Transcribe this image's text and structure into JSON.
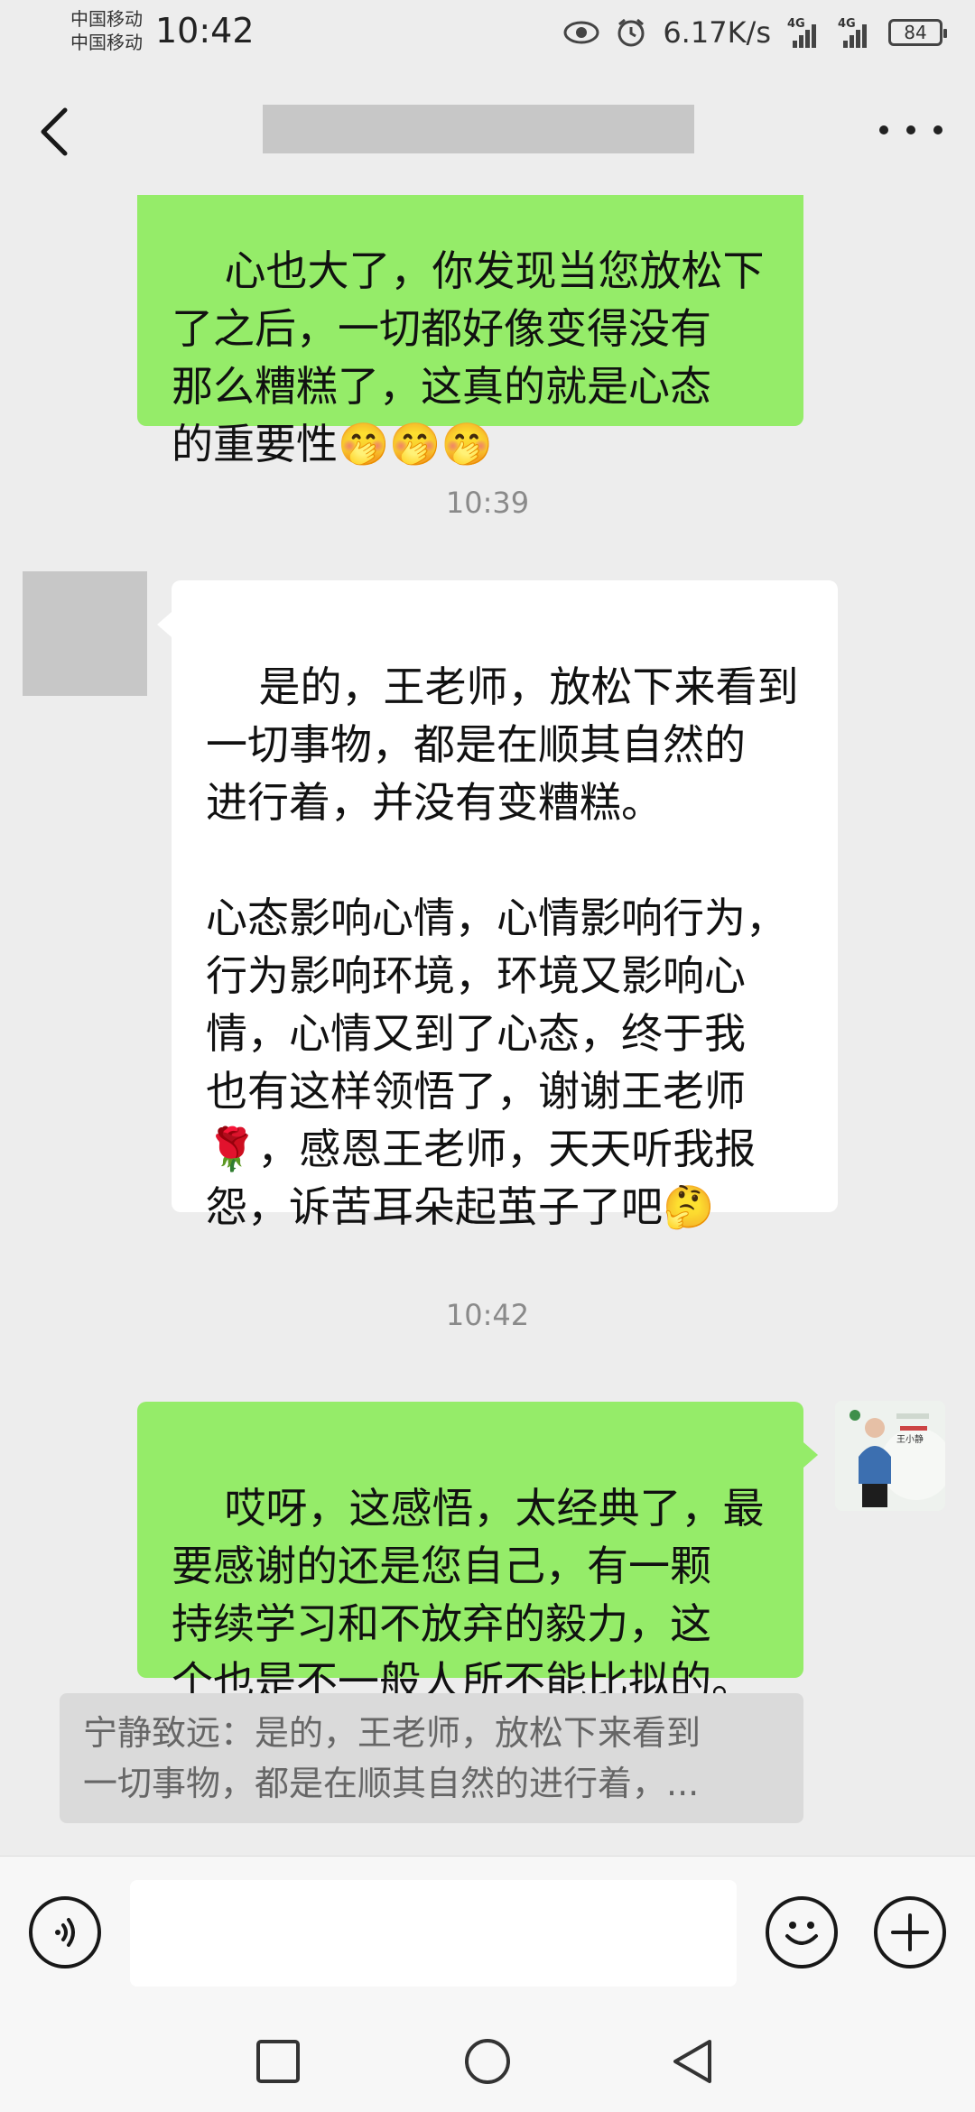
{
  "status_bar": {
    "carrier_1": "中国移动",
    "carrier_2": "中国移动",
    "time": "10:42",
    "net_speed": "6.17K/s",
    "network_1": "4G",
    "network_2": "4G",
    "battery": "84"
  },
  "header": {
    "back_icon": "chevron-left-icon",
    "more_icon": "more-dots-icon"
  },
  "messages": [
    {
      "direction": "outgoing",
      "text": "心也大了，你发现当您放松下\n了之后，一切都好像变得没有\n那么糟糕了，这真的就是心态\n的重要性🤭🤭🤭"
    },
    {
      "type": "timestamp",
      "text": "10:39"
    },
    {
      "direction": "incoming",
      "text": "是的，王老师，放松下来看到\n一切事物，都是在顺其自然的\n进行着，并没有变糟糕。\n\n心态影响心情，心情影响行为，\n行为影响环境，环境又影响心\n情，心情又到了心态，终于我\n也有这样领悟了，谢谢王老师\n🌹，感恩王老师，天天听我报\n怨，诉苦耳朵起茧子了吧🤔"
    },
    {
      "type": "timestamp",
      "text": "10:42"
    },
    {
      "direction": "outgoing",
      "text": "哎呀，这感悟，太经典了，最\n要感谢的还是您自己，有一颗\n持续学习和不放弃的毅力，这\n个也是不一般人所不能比拟的。"
    }
  ],
  "quote": {
    "text": "宁静致远：是的，王老师，放松下来看到\n一切事物，都是在顺其自然的进行着，..."
  },
  "avatar_label": "王小静",
  "input_bar": {
    "voice_icon": "voice-icon",
    "emoji_icon": "emoji-icon",
    "plus_icon": "plus-icon",
    "placeholder": ""
  },
  "system_nav": {
    "recent_icon": "square-icon",
    "home_icon": "circle-icon",
    "back_icon": "triangle-back-icon"
  },
  "colors": {
    "outgoing_bubble": "#95ec69",
    "incoming_bubble": "#ffffff",
    "background": "#ededed"
  }
}
